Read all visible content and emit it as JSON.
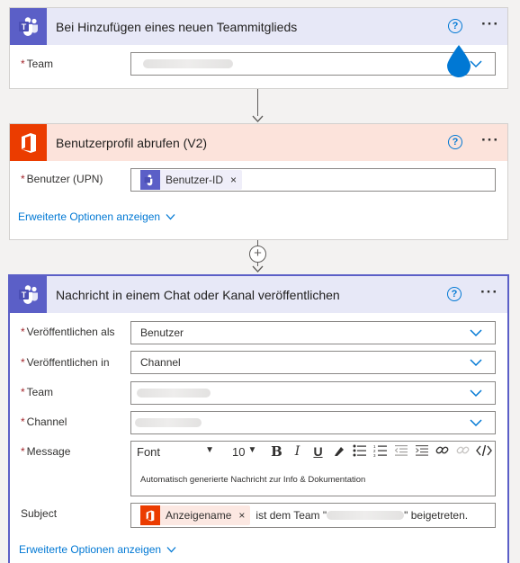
{
  "card1": {
    "title": "Bei Hinzufügen eines neuen Teammitglieds",
    "help": "?",
    "more": "···",
    "team_label": "Team",
    "team_value": ""
  },
  "card2": {
    "title": "Benutzerprofil abrufen (V2)",
    "help": "?",
    "more": "···",
    "user_label": "Benutzer (UPN)",
    "user_token": "Benutzer-ID",
    "token_close": "×",
    "advanced": "Erweiterte Optionen anzeigen"
  },
  "add_step": "+",
  "card3": {
    "title": "Nachricht in einem Chat oder Kanal veröffentlichen",
    "help": "?",
    "more": "···",
    "post_as_label": "Veröffentlichen als",
    "post_as_value": "Benutzer",
    "post_in_label": "Veröffentlichen in",
    "post_in_value": "Channel",
    "team_label": "Team",
    "channel_label": "Channel",
    "message_label": "Message",
    "toolbar": {
      "font": "Font",
      "font_arrow": "▼",
      "size": "10",
      "size_arrow": "▼",
      "bold": "B",
      "italic": "I",
      "underline": "U"
    },
    "message_text": "Automatisch generierte Nachricht zur Info & Dokumentation",
    "subject_label": "Subject",
    "subject_token": "Anzeigename",
    "token_close": "×",
    "subject_text_1": "ist dem Team \"",
    "subject_text_2": "\" beigetreten.",
    "advanced": "Erweiterte Optionen anzeigen"
  },
  "required_mark": "*",
  "colors": {
    "teams": "#5b5fc7",
    "office": "#eb3c00",
    "accent": "#0078d4",
    "required": "#a4262c"
  }
}
